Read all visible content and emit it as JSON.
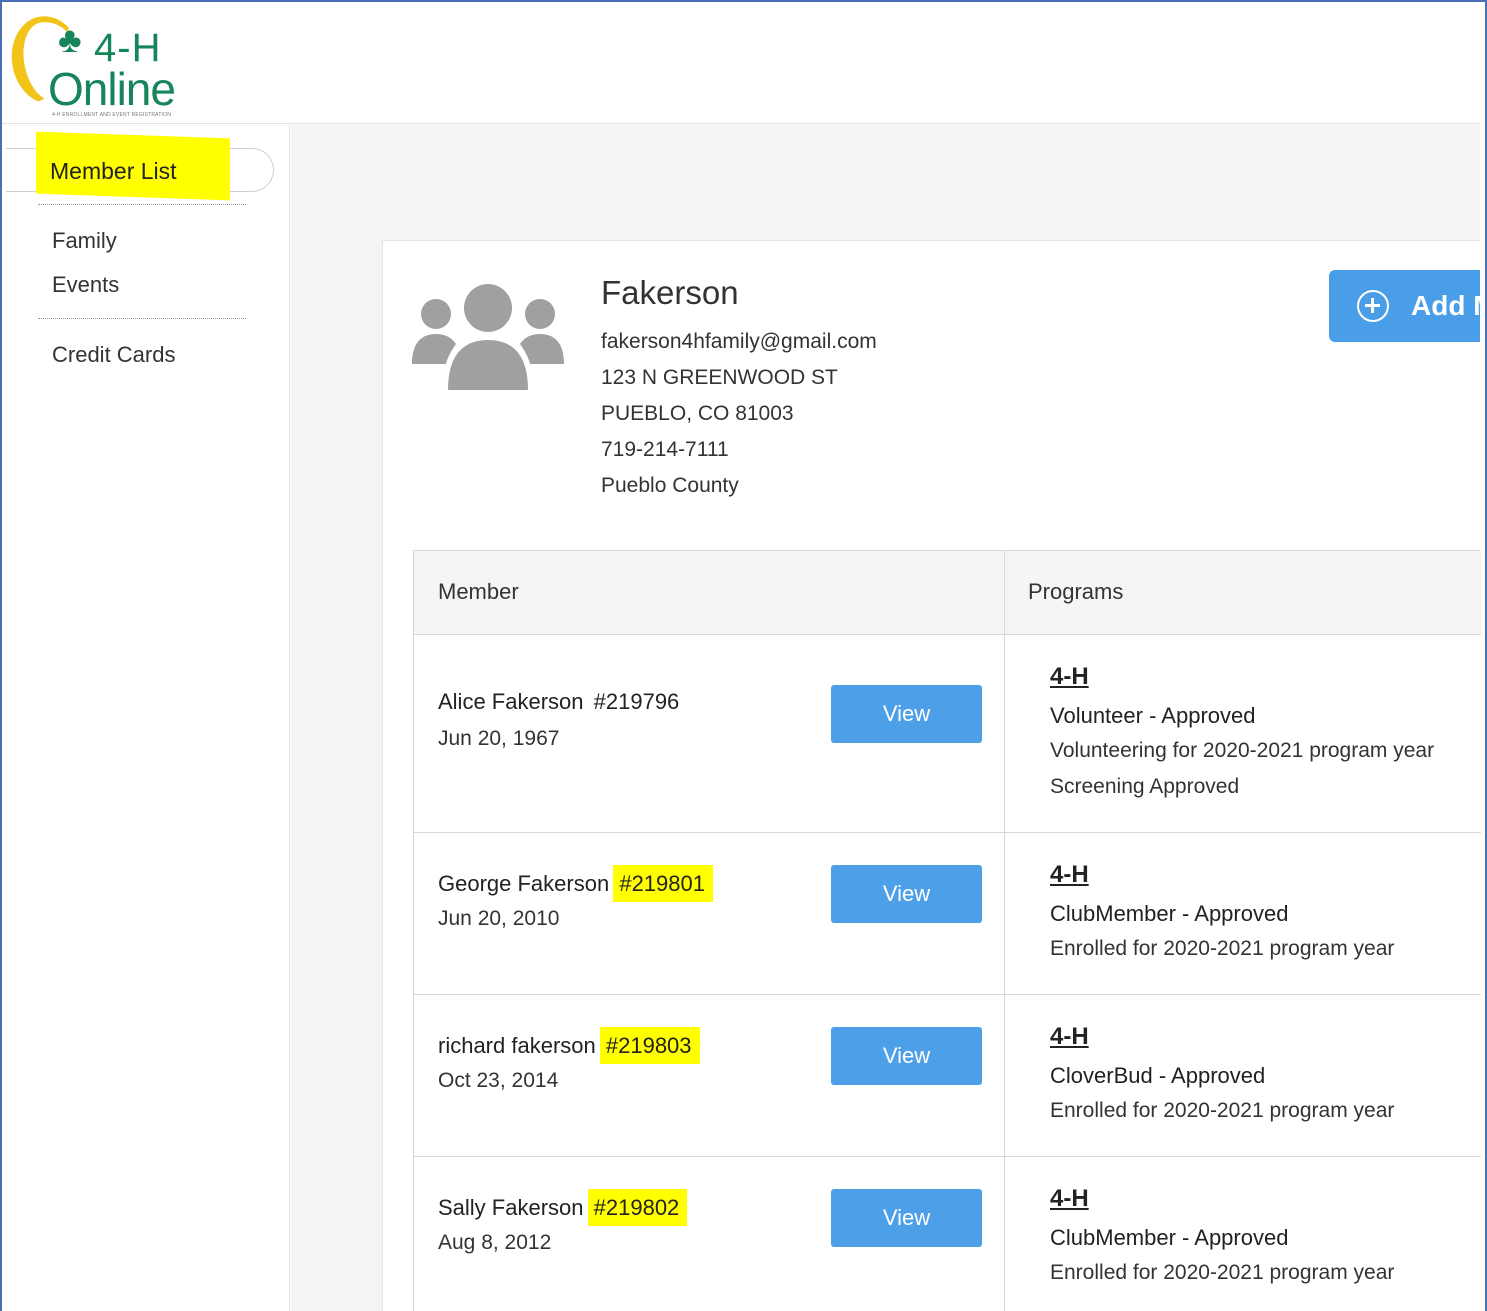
{
  "logo": {
    "brand_top": "4-H",
    "brand_bottom": "Online",
    "tagline": "4-H ENROLLMENT AND EVENT REGISTRATION"
  },
  "sidebar": {
    "items": [
      {
        "label": "Member List",
        "active": true
      },
      {
        "label": "Family"
      },
      {
        "label": "Events"
      },
      {
        "label": "Credit Cards"
      }
    ]
  },
  "family": {
    "name": "Fakerson",
    "email": "fakerson4hfamily@gmail.com",
    "address_line1": "123 N GREENWOOD ST",
    "address_line2": "PUEBLO, CO 81003",
    "phone": "719-214-7111",
    "county": "Pueblo County",
    "add_button_label": "Add M"
  },
  "table": {
    "headers": {
      "member": "Member",
      "programs": "Programs"
    },
    "rows": [
      {
        "name": "Alice Fakerson",
        "id": "#219796",
        "highlighted": false,
        "dob": "Jun 20, 1967",
        "view_label": "View",
        "program": "4-H",
        "status": "Volunteer - Approved",
        "lines": [
          "Volunteering for 2020-2021 program year",
          "Screening Approved"
        ]
      },
      {
        "name": "George Fakerson",
        "id": "#219801",
        "highlighted": true,
        "dob": "Jun 20, 2010",
        "view_label": "View",
        "program": "4-H",
        "status": "ClubMember - Approved",
        "lines": [
          "Enrolled for 2020-2021 program year"
        ]
      },
      {
        "name": "richard fakerson",
        "id": "#219803",
        "highlighted": true,
        "dob": "Oct 23, 2014",
        "view_label": "View",
        "program": "4-H",
        "status": "CloverBud - Approved",
        "lines": [
          "Enrolled for 2020-2021 program year"
        ]
      },
      {
        "name": "Sally Fakerson",
        "id": "#219802",
        "highlighted": true,
        "dob": "Aug 8, 2012",
        "view_label": "View",
        "program": "4-H",
        "status": "ClubMember - Approved",
        "lines": [
          "Enrolled for 2020-2021 program year"
        ]
      }
    ]
  },
  "colors": {
    "brand_green": "#16855b",
    "brand_yellow": "#f2c318",
    "button_blue": "#4da0e8",
    "highlight": "#ffff00"
  }
}
